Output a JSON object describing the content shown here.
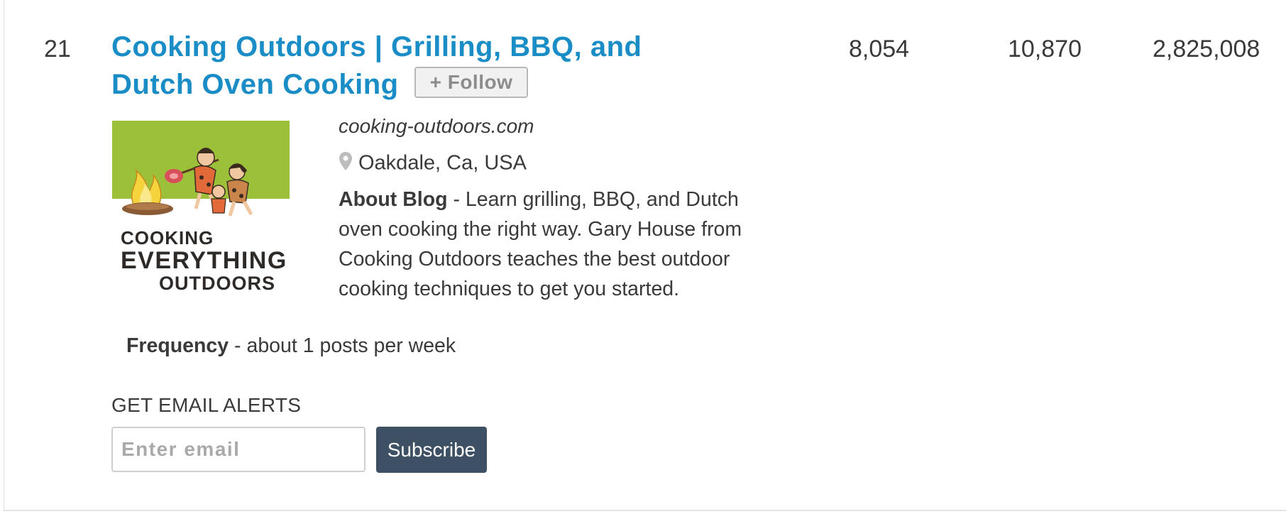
{
  "listing": {
    "rank": "21",
    "title": "Cooking Outdoors | Grilling, BBQ, and Dutch Oven Cooking",
    "follow_label": "+ Follow",
    "stats": [
      "8,054",
      "10,870",
      "2,825,008"
    ],
    "domain": "cooking-outdoors.com",
    "location": "Oakdale, Ca, USA",
    "about_label": "About Blog",
    "about_text": " - Learn grilling, BBQ, and Dutch oven cooking the right way. Gary House from Cooking Outdoors teaches the best outdoor cooking techniques to get you started.",
    "frequency_label": "Frequency",
    "frequency_text": " - about 1 posts per week",
    "logo": {
      "line1": "COOKING",
      "line2": "EVERYTHING",
      "line3": "OUTDOORS"
    }
  },
  "alerts": {
    "label": "GET EMAIL ALERTS",
    "placeholder": "Enter email",
    "subscribe_label": "Subscribe"
  },
  "colors": {
    "title_link": "#1a8dc6",
    "subscribe_bg": "#3e5063",
    "logo_green": "#9dc03b"
  },
  "icons": [
    "map-pin-icon"
  ]
}
